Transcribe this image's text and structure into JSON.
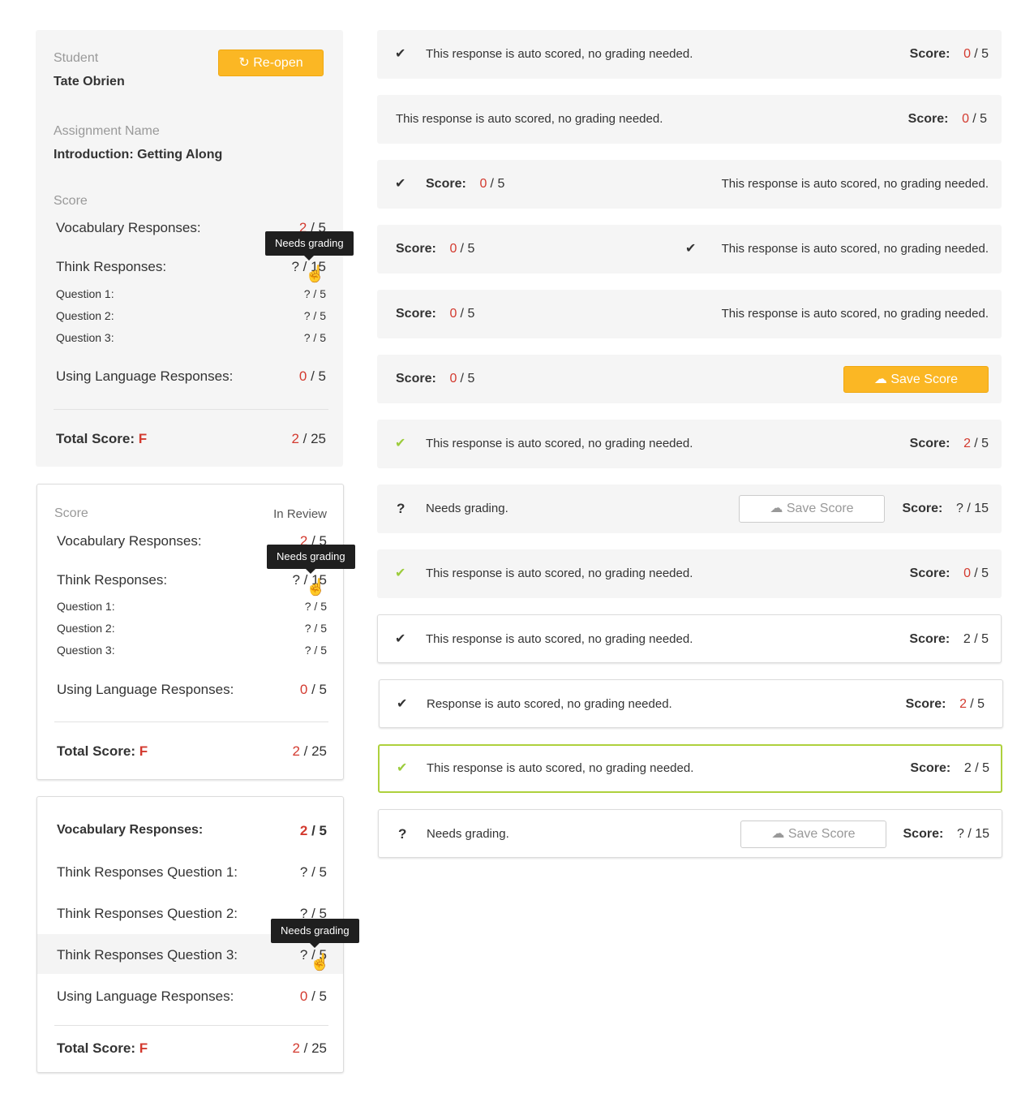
{
  "panel1": {
    "student_label": "Student",
    "student_name": "Tate Obrien",
    "reopen_label": "Re-open",
    "assignment_label": "Assignment Name",
    "assignment_name": "Introduction: Getting Along",
    "score_label": "Score",
    "vocab_label": "Vocabulary Responses:",
    "vocab_score": "2",
    "vocab_total": "/ 5",
    "think_label": "Think Responses:",
    "think_score": "? / 15",
    "tooltip": "Needs grading",
    "q1_label": "Question 1:",
    "q1_score": "? / 5",
    "q2_label": "Question 2:",
    "q2_score": "? / 5",
    "q3_label": "Question 3:",
    "q3_score": "? / 5",
    "lang_label": "Using Language Responses:",
    "lang_score": "0",
    "lang_total": "/ 5",
    "total_label": "Total Score:",
    "total_grade": "F",
    "total_score": "2",
    "total_total": "/ 25"
  },
  "panel2": {
    "score_label": "Score",
    "status": "In Review",
    "vocab_label": "Vocabulary Responses:",
    "vocab_score": "2",
    "vocab_total": "/ 5",
    "think_label": "Think Responses:",
    "think_score": "? / 15",
    "tooltip": "Needs grading",
    "q1_label": "Question 1:",
    "q1_score": "? / 5",
    "q2_label": "Question 2:",
    "q2_score": "? / 5",
    "q3_label": "Question 3:",
    "q3_score": "? / 5",
    "lang_label": "Using Language Responses:",
    "lang_score": "0",
    "lang_total": "/ 5",
    "total_label": "Total Score:",
    "total_grade": "F",
    "total_score": "2",
    "total_total": "/ 25"
  },
  "panel3": {
    "vocab_label": "Vocabulary Responses:",
    "vocab_score": "2",
    "vocab_total": "/ 5",
    "tq1_label": "Think Responses Question 1:",
    "tq1_score": "? / 5",
    "tq2_label": "Think Responses Question 2:",
    "tq2_score": "? / 5",
    "tq3_label": "Think Responses Question 3:",
    "tq3_score": "? / 5",
    "tooltip": "Needs grading",
    "lang_label": "Using Language Responses:",
    "lang_score": "0",
    "lang_total": "/ 5",
    "total_label": "Total Score:",
    "total_grade": "F",
    "total_score": "2",
    "total_total": "/ 25"
  },
  "rows": {
    "auto_text": "This response is auto scored, no grading needed.",
    "auto_text_short": "Response is auto scored, no grading needed.",
    "needs_text": "Needs grading.",
    "score_label": "Score:",
    "save_label": "Save Score",
    "zero": "0",
    "two": "2",
    "of5": "/ 5",
    "q15": "? / 15",
    "two_of5": "2 / 5"
  },
  "colors": {
    "accent_yellow": "#fbb724",
    "error_red": "#d33a2f",
    "success_green": "#9ccc3c",
    "panel_grey": "#f5f5f5"
  }
}
